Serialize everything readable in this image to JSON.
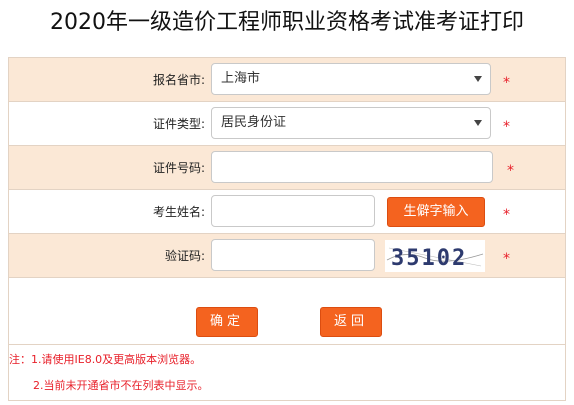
{
  "page": {
    "title": "2020年一级造价工程师职业资格考试准考证打印"
  },
  "form": {
    "province": {
      "label": "报名省市:",
      "value": "上海市"
    },
    "id_type": {
      "label": "证件类型:",
      "value": "居民身份证"
    },
    "id_number": {
      "label": "证件号码:",
      "value": ""
    },
    "name": {
      "label": "考生姓名:",
      "value": "",
      "rare_button": "生僻字输入"
    },
    "captcha": {
      "label": "验证码:",
      "value": "",
      "image_text": "35102"
    },
    "required_mark": "*"
  },
  "buttons": {
    "confirm": "确定",
    "back": "返回"
  },
  "notes": {
    "line1": "注：1.请使用IE8.0及更高版本浏览器。",
    "line2": "2.当前未开通省市不在列表中显示。"
  },
  "colors": {
    "row_tint": "#fbe8d6",
    "button_orange": "#f4631f",
    "required_red": "#e8202a"
  }
}
